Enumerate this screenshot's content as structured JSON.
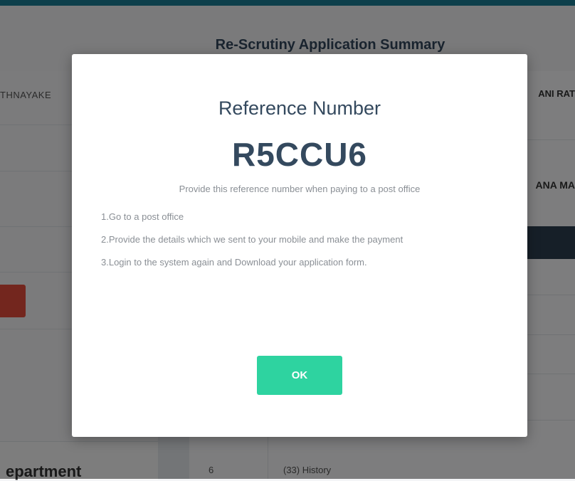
{
  "background": {
    "page_title": "Re-Scrutiny Application Summary",
    "left_name_fragment": "THNAYAKE",
    "right_name_fragment_1": "ANI RAT",
    "right_name_fragment_2": "ANA MA",
    "left_section_fragment": "epartment",
    "table_row": {
      "number": "6",
      "subject": "(33) History"
    }
  },
  "modal": {
    "heading": "Reference Number",
    "reference_code": "R5CCU6",
    "hint": "Provide this reference number when paying to a post office",
    "steps": [
      "1.Go to a post office",
      "2.Provide the details which we sent to your mobile and make the payment",
      "3.Login to the system again and Download your application form."
    ],
    "ok_label": "OK"
  },
  "colors": {
    "accent_top_bar": "#1a7f96",
    "ok_button": "#2ed3a0",
    "danger_button": "#e74c3c",
    "dark_bar": "#2c3e50"
  }
}
